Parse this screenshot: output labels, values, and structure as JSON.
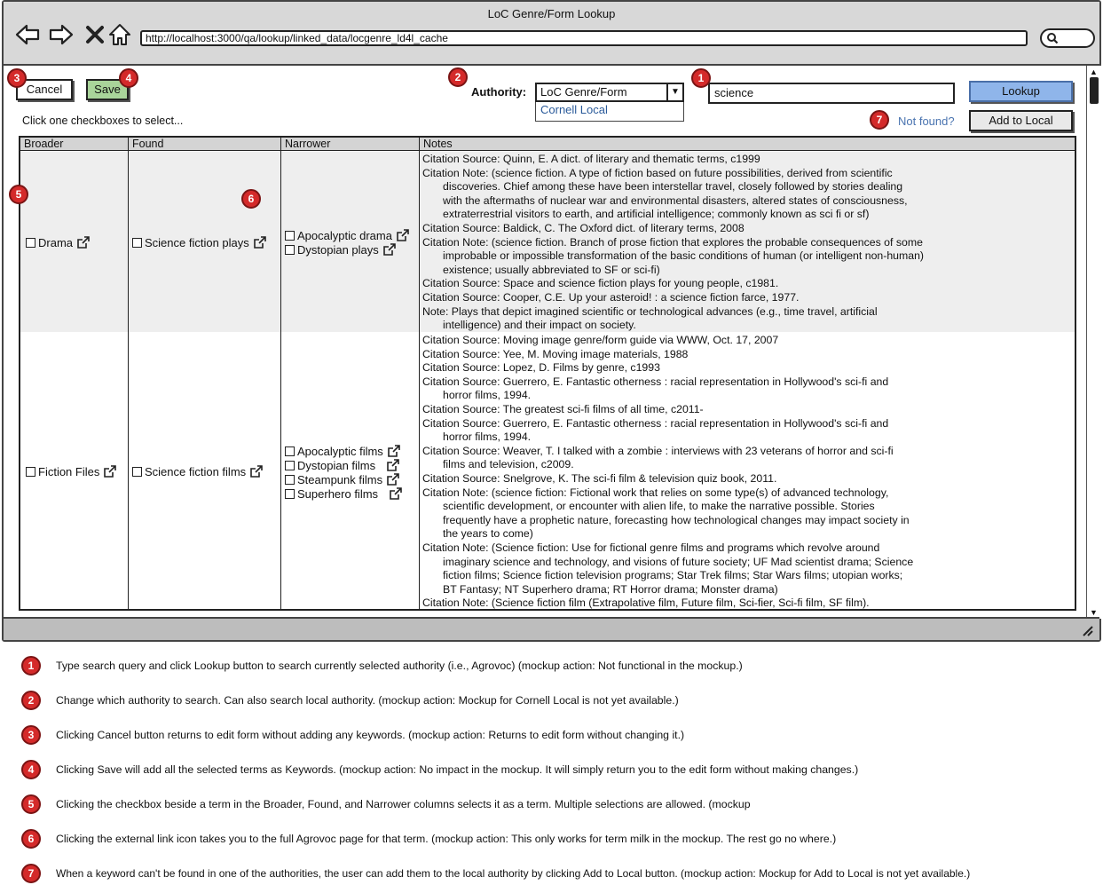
{
  "window": {
    "title": "LoC Genre/Form Lookup",
    "url": "http://localhost:3000/qa/lookup/linked_data/locgenre_ld4l_cache"
  },
  "toolbar": {
    "cancel_label": "Cancel",
    "save_label": "Save",
    "authority_label": "Authority:",
    "authority_selected": "LoC Genre/Form",
    "authority_option": "Cornell Local",
    "search_value": "science",
    "lookup_label": "Lookup",
    "instruction": "Click one checkboxes to select...",
    "not_found_label": "Not found?",
    "add_local_label": "Add to Local"
  },
  "badges": [
    "1",
    "2",
    "3",
    "4",
    "5",
    "6",
    "7"
  ],
  "table": {
    "headers": [
      "Broader",
      "Found",
      "Narrower",
      "Notes"
    ],
    "rows": [
      {
        "broader": "Drama",
        "found": "Science fiction plays",
        "narrower": [
          "Apocalyptic drama",
          "Dystopian plays"
        ],
        "notes": [
          {
            "text": "Citation Source: Quinn, E. A dict. of literary and thematic terms, c1999",
            "indent": false
          },
          {
            "text": "Citation Note: (science fiction. A type of fiction based on future possibilities, derived from scientific",
            "indent": false
          },
          {
            "text": "discoveries. Chief among these have been interstellar travel, closely followed by stories dealing",
            "indent": true
          },
          {
            "text": "with the aftermaths of nuclear war and environmental disasters, altered states of consciousness,",
            "indent": true
          },
          {
            "text": "extraterrestrial visitors to earth, and artificial intelligence; commonly known as sci fi or sf)",
            "indent": true
          },
          {
            "text": "Citation Source: Baldick, C. The Oxford dict. of literary terms, 2008",
            "indent": false
          },
          {
            "text": "Citation Note: (science fiction. Branch of prose fiction that explores the probable consequences of some",
            "indent": false
          },
          {
            "text": "improbable or impossible transformation of the basic conditions of human (or intelligent non-human)",
            "indent": true
          },
          {
            "text": "existence; usually abbreviated to SF or sci-fi)",
            "indent": true
          },
          {
            "text": "Citation Source: Space and science fiction plays for young people, c1981.",
            "indent": false
          },
          {
            "text": "Citation Source: Cooper, C.E. Up your asteroid! : a science fiction farce, 1977.",
            "indent": false
          },
          {
            "text": "Note:  Plays that depict imagined scientific or technological advances (e.g., time travel, artificial",
            "indent": false
          },
          {
            "text": "intelligence) and their impact on society.",
            "indent": true
          }
        ]
      },
      {
        "broader": "Fiction Files",
        "found": "Science fiction films",
        "narrower": [
          "Apocalyptic films",
          "Dystopian films",
          "Steampunk films",
          "Superhero films"
        ],
        "notes": [
          {
            "text": "Citation Source: Moving image genre/form guide via WWW, Oct. 17, 2007",
            "indent": false
          },
          {
            "text": "Citation Source: Yee, M. Moving image materials, 1988",
            "indent": false
          },
          {
            "text": "Citation Source: Lopez, D. Films by genre, c1993",
            "indent": false
          },
          {
            "text": "Citation Source: Guerrero, E. Fantastic otherness : racial representation in Hollywood's sci-fi and",
            "indent": false
          },
          {
            "text": "horror films, 1994.",
            "indent": true
          },
          {
            "text": "Citation Source: The greatest sci-fi films of all time, c2011-",
            "indent": false
          },
          {
            "text": "Citation Source: Guerrero, E. Fantastic otherness : racial representation in Hollywood's sci-fi and",
            "indent": false
          },
          {
            "text": "horror films, 1994.",
            "indent": true
          },
          {
            "text": "Citation Source: Weaver, T. I talked with a zombie : interviews with 23 veterans of horror and sci-fi",
            "indent": false
          },
          {
            "text": "films and television, c2009.",
            "indent": true
          },
          {
            "text": "Citation Source: Snelgrove, K. The sci-fi film & television quiz book, 2011.",
            "indent": false
          },
          {
            "text": "Citation Note: (science fiction: Fictional work that relies on some type(s) of advanced technology,",
            "indent": false
          },
          {
            "text": "scientific development, or encounter with alien life, to make the narrative possible. Stories",
            "indent": true
          },
          {
            "text": "frequently have a prophetic nature, forecasting how technological changes may impact society in",
            "indent": true
          },
          {
            "text": "the years to come)",
            "indent": true
          },
          {
            "text": "Citation Note: (Science fiction: Use for fictional genre films and programs which revolve around",
            "indent": false
          },
          {
            "text": "imaginary science and technology, and visions of future society; UF Mad scientist drama; Science",
            "indent": true
          },
          {
            "text": "fiction films; Science fiction television programs; Star Trek films; Star Wars films; utopian works;",
            "indent": true
          },
          {
            "text": "BT Fantasy; NT Superhero drama; RT Horror drama; Monster drama)",
            "indent": true
          },
          {
            "text": "Citation Note: (Science fiction film (Extrapolative film, Future film, Sci-fier, Sci-fi film, SF film).",
            "indent": false
          }
        ]
      }
    ]
  },
  "legend": [
    {
      "num": "1",
      "text": "Type search query and click Lookup button to search currently selected authority (i.e., Agrovoc)  (mockup action: Not functional in the mockup.)"
    },
    {
      "num": "2",
      "text": "Change which authority to search.  Can also search local authority.  (mockup action: Mockup for Cornell Local is not yet available.)"
    },
    {
      "num": "3",
      "text": "Clicking Cancel button returns to edit form without adding any keywords.  (mockup action: Returns to edit form without changing it.)"
    },
    {
      "num": "4",
      "text": "Clicking Save will add all the selected terms as Keywords.  (mockup action: No impact in the mockup.  It will simply return you to the edit form without making changes.)"
    },
    {
      "num": "5",
      "text": "Clicking the checkbox beside a term in the Broader, Found, and Narrower columns selects it as a term.  Multiple selections are allowed.  (mockup"
    },
    {
      "num": "6",
      "text": "Clicking the external link icon takes you to the full Agrovoc page for that term.  (mockup action: This only works for term milk in the mockup.  The rest go no where.)"
    },
    {
      "num": "7",
      "text": "When a keyword can't be found in one of the authorities, the user can add them to the local authority by clicking Add to Local button. (mockup action: Mockup for Add to Local is not yet available.)"
    }
  ],
  "colors": {
    "badge": "#d42a2a",
    "save": "#a9d49a",
    "lookup": "#8fb5ea",
    "link": "#4a74b0",
    "row_highlight": "#eeeeee"
  }
}
